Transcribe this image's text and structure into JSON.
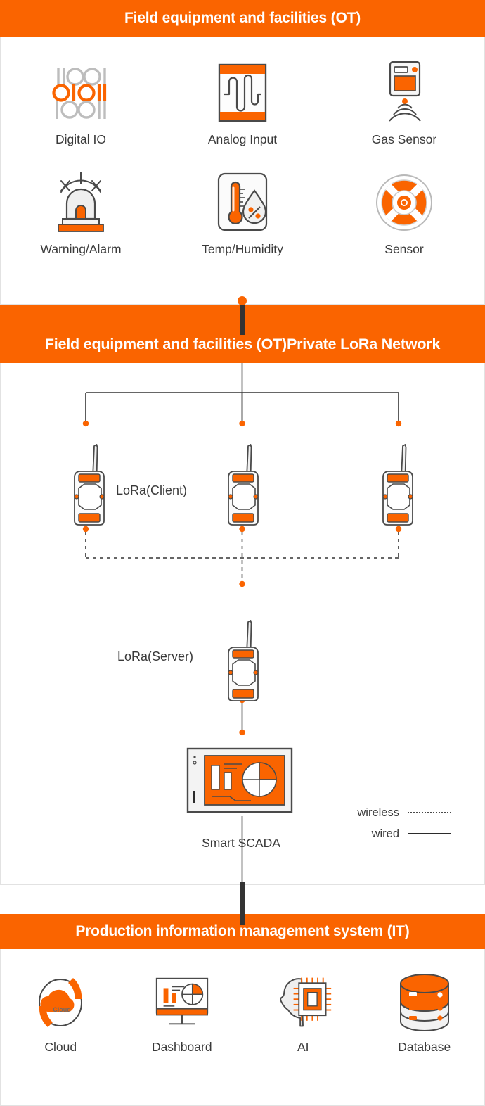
{
  "colors": {
    "accent": "#fa6400",
    "banner_text": "#ffffff",
    "label_text": "#3a3a3a",
    "line": "#333333",
    "panel_border": "#e2e2e2",
    "device_body": "#fbfbfb",
    "device_stroke": "#4a4a4a",
    "icon_gray": "#e8e8e8"
  },
  "banners": {
    "ot": "Field equipment and facilities (OT)",
    "lora": "Field equipment and facilities (OT)Private LoRa Network",
    "it": "Production information management system (IT)"
  },
  "ot_section": {
    "row1": [
      {
        "label": "Digital IO",
        "icon": "digital-io-icon"
      },
      {
        "label": "Analog Input",
        "icon": "analog-input-icon"
      },
      {
        "label": "Gas Sensor",
        "icon": "gas-sensor-icon"
      }
    ],
    "row2": [
      {
        "label": "Warning/Alarm",
        "icon": "warning-alarm-icon"
      },
      {
        "label": "Temp/Humidity",
        "icon": "temp-humidity-icon"
      },
      {
        "label": "Sensor",
        "icon": "sensor-icon"
      }
    ]
  },
  "network_section": {
    "client_label": "LoRa(Client)",
    "server_label": "LoRa(Server)",
    "scada_label": "Smart SCADA",
    "client_count": 3,
    "legend": [
      {
        "label": "wireless",
        "style": "dotted"
      },
      {
        "label": "wired",
        "style": "solid"
      }
    ]
  },
  "it_section": {
    "items": [
      {
        "label": "Cloud",
        "icon": "cloud-icon",
        "inner_text": "Cloud"
      },
      {
        "label": "Dashboard",
        "icon": "dashboard-icon"
      },
      {
        "label": "AI",
        "icon": "ai-chip-head-icon"
      },
      {
        "label": "Database",
        "icon": "database-icon"
      }
    ]
  }
}
